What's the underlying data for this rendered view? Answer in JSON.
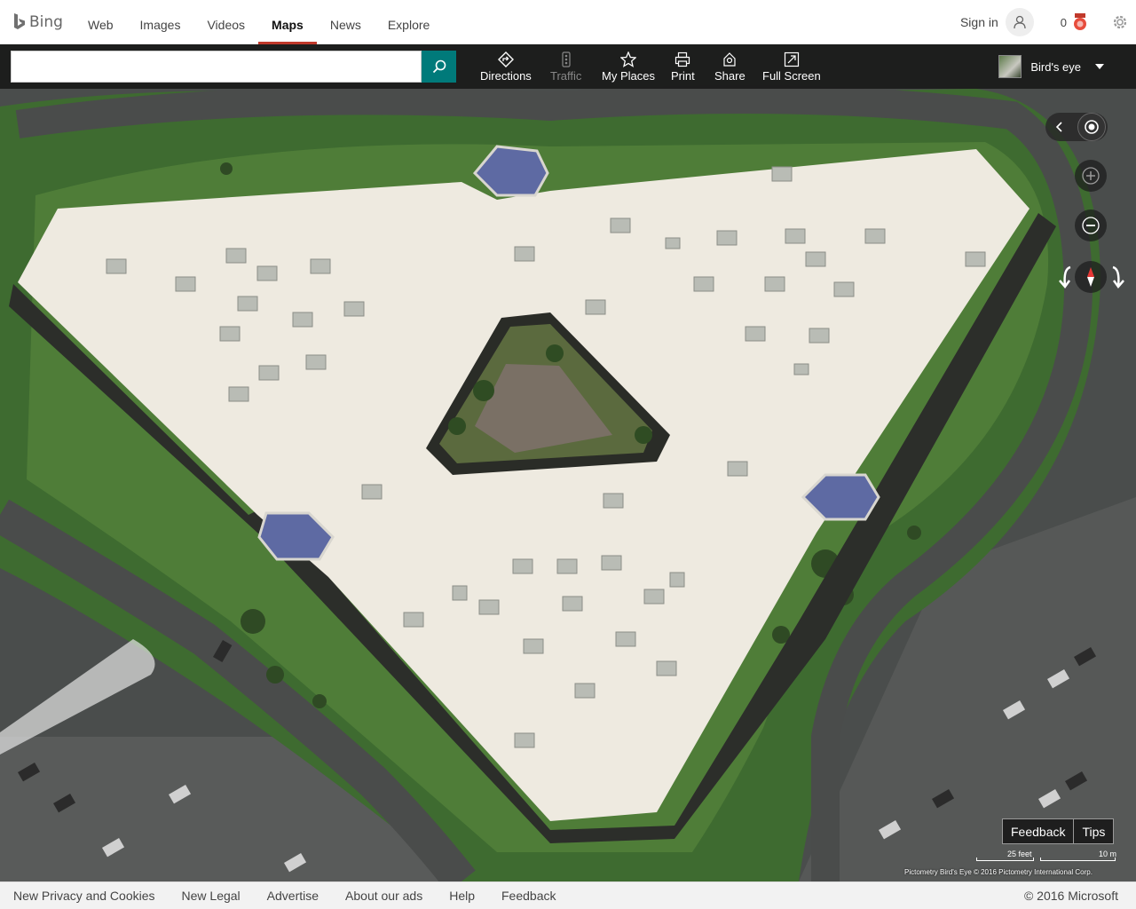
{
  "header": {
    "brand": "Bing",
    "nav": [
      {
        "label": "Web",
        "active": false
      },
      {
        "label": "Images",
        "active": false
      },
      {
        "label": "Videos",
        "active": false
      },
      {
        "label": "Maps",
        "active": true
      },
      {
        "label": "News",
        "active": false
      },
      {
        "label": "Explore",
        "active": false
      }
    ],
    "signin_label": "Sign in",
    "rewards_count": "0",
    "accent_color": "#c0392b"
  },
  "toolbar": {
    "search_value": "",
    "search_placeholder": "",
    "tools": [
      {
        "label": "Directions",
        "icon": "directions-icon",
        "enabled": true
      },
      {
        "label": "Traffic",
        "icon": "traffic-icon",
        "enabled": false
      },
      {
        "label": "My Places",
        "icon": "star-icon",
        "enabled": true
      },
      {
        "label": "Print",
        "icon": "print-icon",
        "enabled": true
      },
      {
        "label": "Share",
        "icon": "share-icon",
        "enabled": true
      },
      {
        "label": "Full Screen",
        "icon": "fullscreen-icon",
        "enabled": true
      }
    ],
    "map_style": "Bird's eye",
    "search_button_color": "#007a7a"
  },
  "map": {
    "feedback_label": "Feedback",
    "tips_label": "Tips",
    "scale_feet": "25 feet",
    "scale_meters": "10 m",
    "attribution": "Pictometry Bird's Eye © 2016 Pictometry International Corp."
  },
  "footer": {
    "links": [
      "New Privacy and Cookies",
      "New Legal",
      "Advertise",
      "About our ads",
      "Help",
      "Feedback"
    ],
    "copyright": "© 2016 Microsoft"
  }
}
